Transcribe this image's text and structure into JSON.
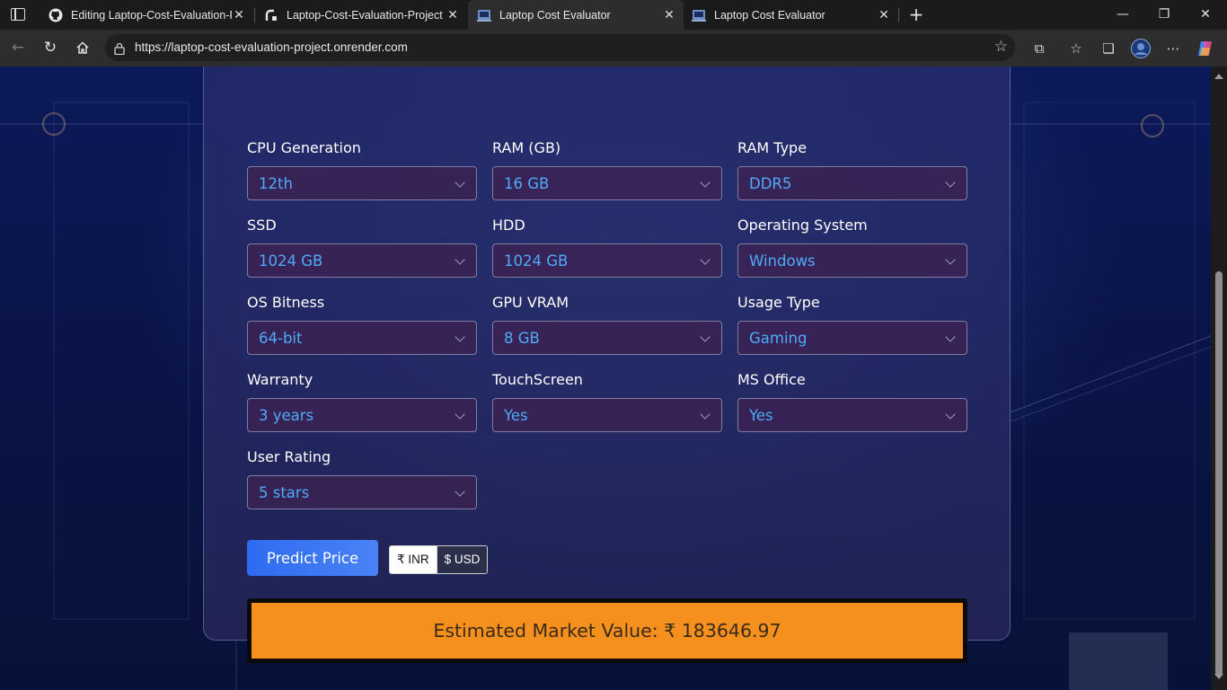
{
  "browser": {
    "tabs": [
      {
        "title": "Editing Laptop-Cost-Evaluation-P",
        "icon": "github-icon",
        "active": false
      },
      {
        "title": "Laptop-Cost-Evaluation-Project ·",
        "icon": "render-icon",
        "active": false
      },
      {
        "title": "Laptop Cost Evaluator",
        "icon": "laptop-icon",
        "active": true
      },
      {
        "title": "Laptop Cost Evaluator",
        "icon": "laptop-icon",
        "active": false
      }
    ],
    "url": "https://laptop-cost-evaluation-project.onrender.com"
  },
  "form": {
    "fields": [
      {
        "label": "CPU Generation",
        "value": "12th"
      },
      {
        "label": "RAM (GB)",
        "value": "16 GB"
      },
      {
        "label": "RAM Type",
        "value": "DDR5"
      },
      {
        "label": "SSD",
        "value": "1024 GB"
      },
      {
        "label": "HDD",
        "value": "1024 GB"
      },
      {
        "label": "Operating System",
        "value": "Windows"
      },
      {
        "label": "OS Bitness",
        "value": "64-bit"
      },
      {
        "label": "GPU VRAM",
        "value": "8 GB"
      },
      {
        "label": "Usage Type",
        "value": "Gaming"
      },
      {
        "label": "Warranty",
        "value": "3 years"
      },
      {
        "label": "TouchScreen",
        "value": "Yes"
      },
      {
        "label": "MS Office",
        "value": "Yes"
      },
      {
        "label": "User Rating",
        "value": "5 stars"
      }
    ],
    "predict_label": "Predict Price",
    "currency": {
      "inr_label": "₹ INR",
      "usd_label": "$ USD",
      "selected": "INR"
    },
    "result_text": "Estimated Market Value: ₹ 183646.97"
  },
  "colors": {
    "accent_blue": "#2e6bf0",
    "select_text": "#4dabf7",
    "result_bg": "#f5901e"
  }
}
